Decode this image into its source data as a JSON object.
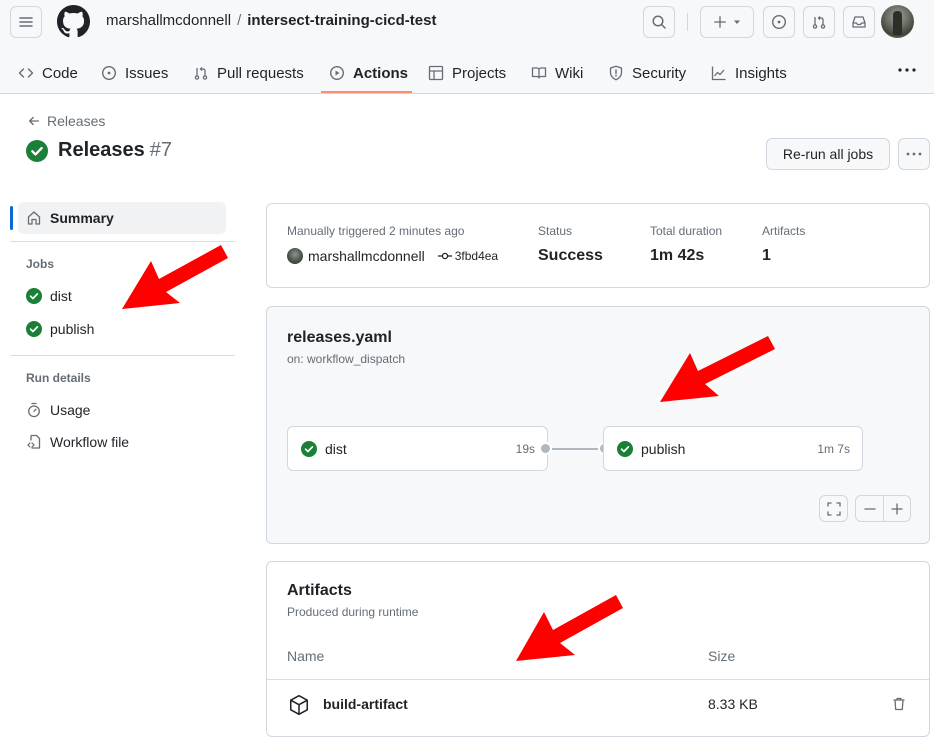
{
  "header": {
    "owner": "marshallmcdonnell",
    "separator": "/",
    "repo": "intersect-training-cicd-test",
    "icons": [
      "hamburger-icon",
      "github-logo",
      "search-icon",
      "plus-icon",
      "issue-icon",
      "pull-request-icon",
      "inbox-icon",
      "user-avatar"
    ]
  },
  "nav": {
    "tabs": [
      {
        "label": "Code",
        "icon": "code-icon"
      },
      {
        "label": "Issues",
        "icon": "issue-icon"
      },
      {
        "label": "Pull requests",
        "icon": "pull-request-icon"
      },
      {
        "label": "Actions",
        "icon": "play-icon",
        "active": true
      },
      {
        "label": "Projects",
        "icon": "table-icon"
      },
      {
        "label": "Wiki",
        "icon": "book-icon"
      },
      {
        "label": "Security",
        "icon": "shield-icon"
      },
      {
        "label": "Insights",
        "icon": "graph-icon"
      }
    ],
    "accent_color": "#fd8c73"
  },
  "page": {
    "back_label": "Releases",
    "title": "Releases",
    "run_number": "#7",
    "rerun_label": "Re-run all jobs"
  },
  "sidebar": {
    "summary_label": "Summary",
    "jobs_heading": "Jobs",
    "jobs": [
      {
        "label": "dist",
        "status": "success"
      },
      {
        "label": "publish",
        "status": "success"
      }
    ],
    "run_details_heading": "Run details",
    "run_details": [
      {
        "label": "Usage",
        "icon": "stopwatch-icon"
      },
      {
        "label": "Workflow file",
        "icon": "file-code-icon"
      }
    ]
  },
  "summary": {
    "trigger_label": "Manually triggered 2 minutes ago",
    "actor": "marshallmcdonnell",
    "commit": "3fbd4ea",
    "status_label": "Status",
    "status_value": "Success",
    "duration_label": "Total duration",
    "duration_value": "1m 42s",
    "artifacts_label": "Artifacts",
    "artifacts_value": "1"
  },
  "workflow": {
    "file": "releases.yaml",
    "trigger": "on: workflow_dispatch",
    "jobs": [
      {
        "name": "dist",
        "duration": "19s",
        "status": "success"
      },
      {
        "name": "publish",
        "duration": "1m 7s",
        "status": "success"
      }
    ]
  },
  "artifacts": {
    "title": "Artifacts",
    "subtitle": "Produced during runtime",
    "columns": [
      "Name",
      "Size"
    ],
    "rows": [
      {
        "name": "build-artifact",
        "size": "8.33 KB"
      }
    ]
  },
  "colors": {
    "success": "#1a7f37",
    "annotation_arrow": "#ff0000",
    "selected_bar": "#0969da"
  }
}
